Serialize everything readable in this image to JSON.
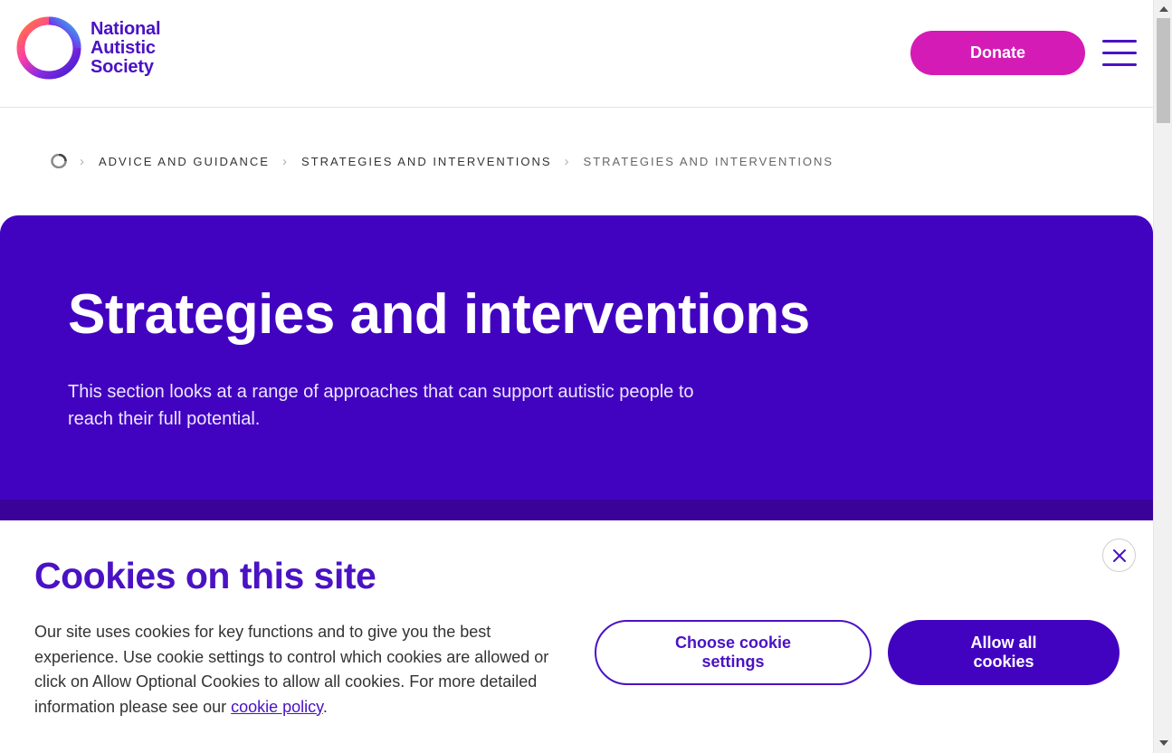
{
  "header": {
    "logo": {
      "line1": "National",
      "line2": "Autistic",
      "line3": "Society",
      "icon": "nas-ring-logo"
    },
    "donate_label": "Donate",
    "menu_icon": "hamburger-menu-icon"
  },
  "breadcrumb": {
    "home_icon": "home-logo-icon",
    "items": [
      {
        "label": "ADVICE AND GUIDANCE"
      },
      {
        "label": "STRATEGIES AND INTERVENTIONS"
      },
      {
        "label": "STRATEGIES AND INTERVENTIONS"
      }
    ],
    "separator_icon": "chevron-right-icon"
  },
  "hero": {
    "title": "Strategies and interventions",
    "description": "This section looks at a range of approaches that can support autistic people to reach their full potential."
  },
  "cookie_banner": {
    "title": "Cookies on this site",
    "body": "Our site uses cookies for key functions and to give you the best experience. Use cookie settings to control which cookies are allowed or click on Allow Optional Cookies to allow all cookies. For more detailed information please see our ",
    "link_label": "cookie policy",
    "body_end": ".",
    "settings_label": "Choose cookie settings",
    "allow_label": "Allow all cookies",
    "close_icon": "close-icon"
  },
  "colors": {
    "brand_purple": "#4203c1",
    "brand_text_purple": "#4a12c4",
    "donate_pink": "#d41bb5"
  }
}
